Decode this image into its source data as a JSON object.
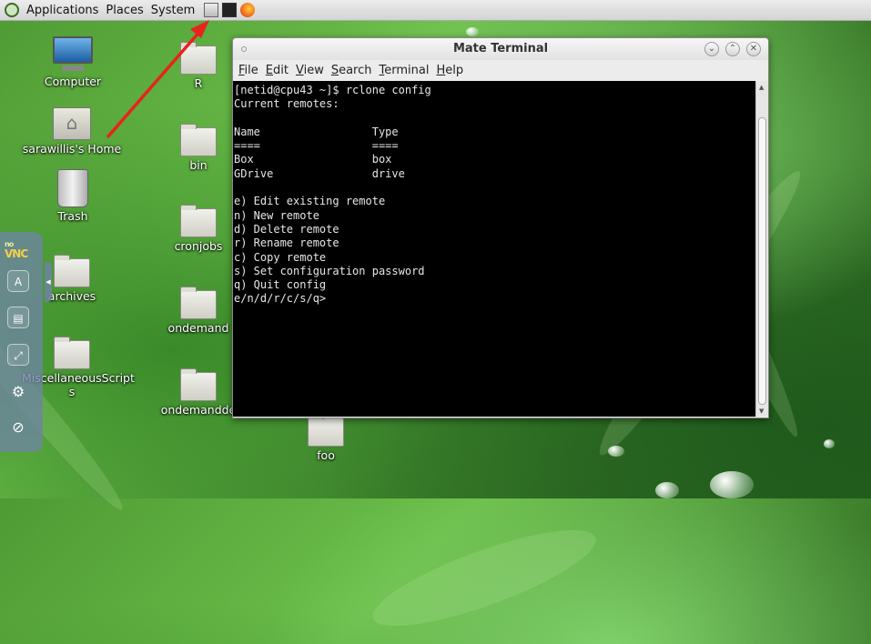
{
  "panel": {
    "menus": [
      "Applications",
      "Places",
      "System"
    ],
    "launchers": [
      "files-icon",
      "terminal-icon",
      "firefox-icon"
    ]
  },
  "desktop": {
    "left_icons": [
      {
        "label": "Computer",
        "icon": "computer-icon"
      },
      {
        "label": "sarawillis's Home",
        "icon": "home-folder-icon"
      },
      {
        "label": "Trash",
        "icon": "trash-icon"
      },
      {
        "label": "archives",
        "icon": "folder-icon"
      },
      {
        "label": "MiscellaneousScript s",
        "icon": "folder-icon"
      }
    ],
    "mid_icons": [
      {
        "label": "R",
        "icon": "folder-icon"
      },
      {
        "label": "bin",
        "icon": "folder-icon"
      },
      {
        "label": "cronjobs",
        "icon": "folder-icon"
      },
      {
        "label": "ondemand",
        "icon": "folder-icon"
      },
      {
        "label": "ondemandde",
        "icon": "folder-icon"
      },
      {
        "label": "foo",
        "icon": "folder-icon"
      }
    ]
  },
  "novnc": {
    "logo_top": "no",
    "logo_bottom": "VNC",
    "buttons": [
      {
        "glyph": "A",
        "icon": "keyboard-extra-keys-icon"
      },
      {
        "glyph": "▤",
        "icon": "clipboard-icon"
      },
      {
        "glyph": "⤢",
        "icon": "fullscreen-icon"
      },
      {
        "glyph": "⚙",
        "icon": "settings-gear-icon"
      },
      {
        "glyph": "⊘",
        "icon": "disconnect-icon"
      }
    ]
  },
  "terminal": {
    "title": "Mate Terminal",
    "menu": [
      "File",
      "Edit",
      "View",
      "Search",
      "Terminal",
      "Help"
    ],
    "window_buttons": [
      "minimize",
      "maximize",
      "close"
    ],
    "lines": [
      "[netid@cpu43 ~]$ rclone config",
      "Current remotes:",
      "",
      "Name                 Type",
      "====                 ====",
      "Box                  box",
      "GDrive               drive",
      "",
      "e) Edit existing remote",
      "n) New remote",
      "d) Delete remote",
      "r) Rename remote",
      "c) Copy remote",
      "s) Set configuration password",
      "q) Quit config",
      "e/n/d/r/c/s/q>"
    ]
  },
  "annotation": {
    "color": "#e8231c"
  }
}
